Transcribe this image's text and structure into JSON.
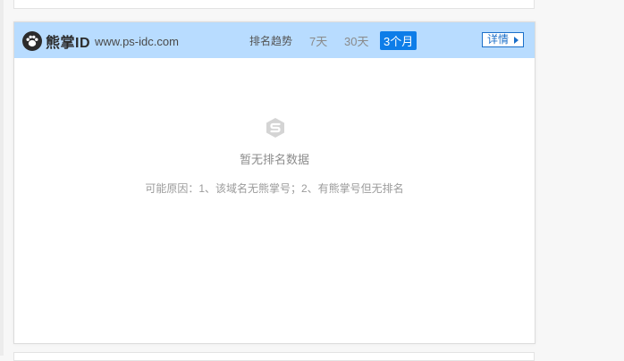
{
  "header": {
    "brand_name": "熊掌ID",
    "domain": "www.ps-idc.com",
    "trend_label": "排名趋势",
    "tabs": [
      {
        "label": "7天",
        "active": false
      },
      {
        "label": "30天",
        "active": false
      },
      {
        "label": "3个月",
        "active": true
      }
    ],
    "detail_label": "详情",
    "background": "#b8dcff",
    "active_tab_color": "#0e7de8"
  },
  "empty_state": {
    "icon": "s-logo-icon",
    "title": "暂无排名数据",
    "reason": "可能原因：1、该域名无熊掌号；2、有熊掌号但无排名"
  }
}
